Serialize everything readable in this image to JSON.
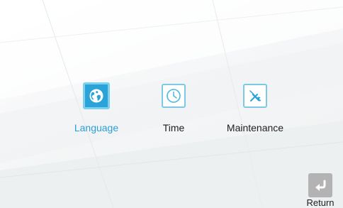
{
  "menu": {
    "items": [
      {
        "label": "Language",
        "icon": "globe-icon",
        "selected": true
      },
      {
        "label": "Time",
        "icon": "clock-icon",
        "selected": false
      },
      {
        "label": "Maintenance",
        "icon": "wrench-icon",
        "selected": false
      }
    ]
  },
  "footer": {
    "return_label": "Return",
    "return_icon": "return-arrow-icon"
  },
  "colors": {
    "accent": "#2aa3d8",
    "accent_light": "#7cc9e6",
    "selected_text": "#2a9fd6",
    "text": "#1e1e1e",
    "return_button": "#b3b3b3"
  }
}
